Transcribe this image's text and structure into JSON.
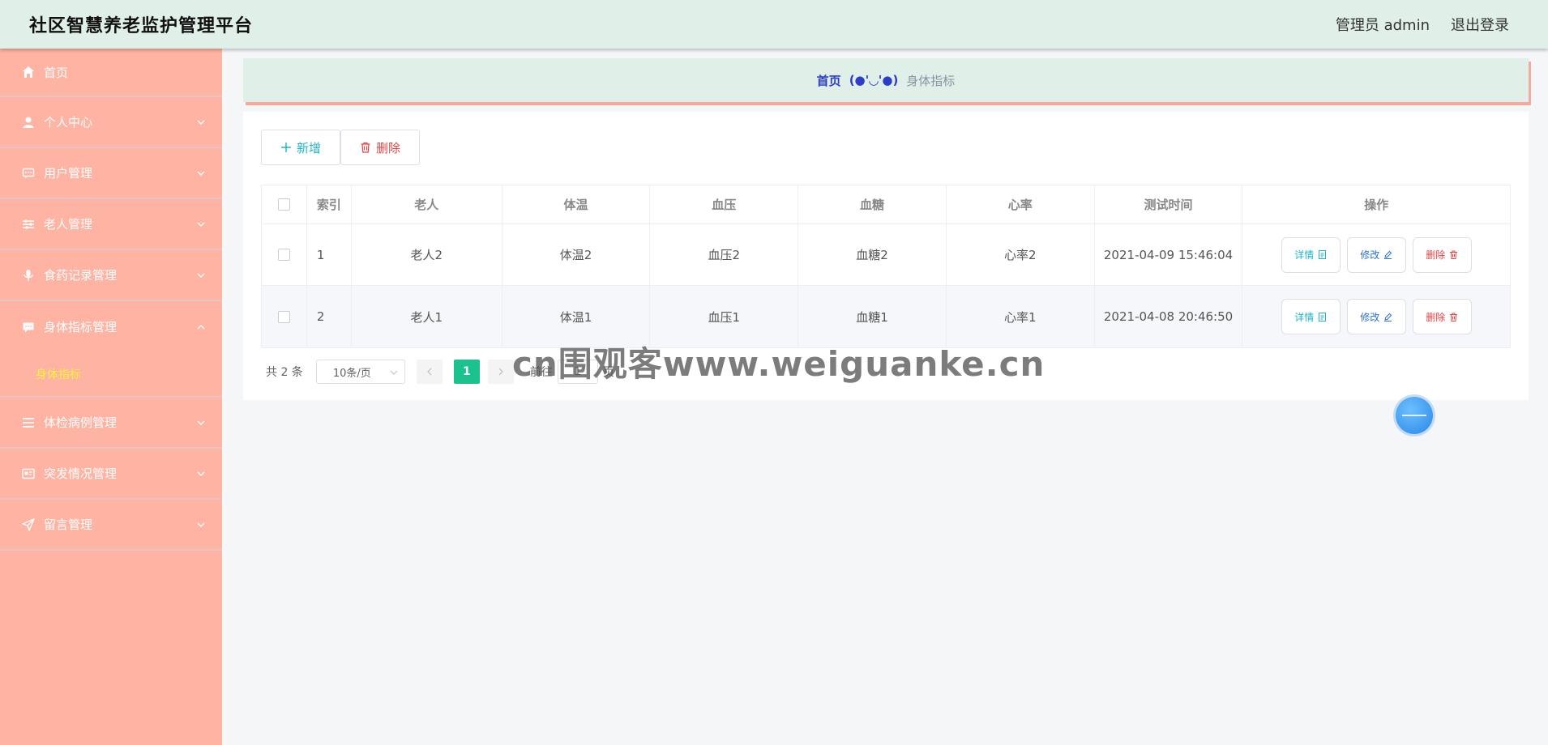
{
  "header": {
    "title": "社区智慧养老监护管理平台",
    "user": "管理员 admin",
    "logout": "退出登录"
  },
  "sidebar": {
    "items": [
      {
        "label": "首页",
        "icon": "home-icon"
      },
      {
        "label": "个人中心",
        "icon": "user-icon"
      },
      {
        "label": "用户管理",
        "icon": "chat-icon"
      },
      {
        "label": "老人管理",
        "icon": "sliders-icon"
      },
      {
        "label": "食药记录管理",
        "icon": "mic-icon"
      },
      {
        "label": "身体指标管理",
        "icon": "message-icon",
        "submenu": [
          "身体指标"
        ]
      },
      {
        "label": "体检病例管理",
        "icon": "list-icon"
      },
      {
        "label": "突发情况管理",
        "icon": "card-icon"
      },
      {
        "label": "留言管理",
        "icon": "send-icon"
      }
    ]
  },
  "breadcrumb": {
    "home": "首页",
    "separator": "(●'◡'●)",
    "current": "身体指标"
  },
  "toolbar": {
    "add_label": "新增",
    "delete_label": "删除"
  },
  "table": {
    "headers": [
      "索引",
      "老人",
      "体温",
      "血压",
      "血糖",
      "心率",
      "测试时间",
      "操作"
    ],
    "rows": [
      {
        "index": "1",
        "elder": "老人2",
        "temp": "体温2",
        "bp": "血压2",
        "sugar": "血糖2",
        "rate": "心率2",
        "time": "2021-04-09 15:46:04"
      },
      {
        "index": "2",
        "elder": "老人1",
        "temp": "体温1",
        "bp": "血压1",
        "sugar": "血糖1",
        "rate": "心率1",
        "time": "2021-04-08 20:46:50"
      }
    ],
    "actions": {
      "detail": "详情",
      "edit": "修改",
      "delete": "删除"
    }
  },
  "pagination": {
    "total": "共 2 条",
    "page_size": "10条/页",
    "current_page": "1",
    "goto_prefix": "前往",
    "goto_value": "1",
    "goto_suffix": "页"
  },
  "watermark": "cn围观客www.weiguanke.cn",
  "colors": {
    "header_bg": "#e0efe8",
    "sidebar_bg": "#ffb3a3",
    "active_submenu": "#f9f23a",
    "page_active": "#1bc28d"
  }
}
